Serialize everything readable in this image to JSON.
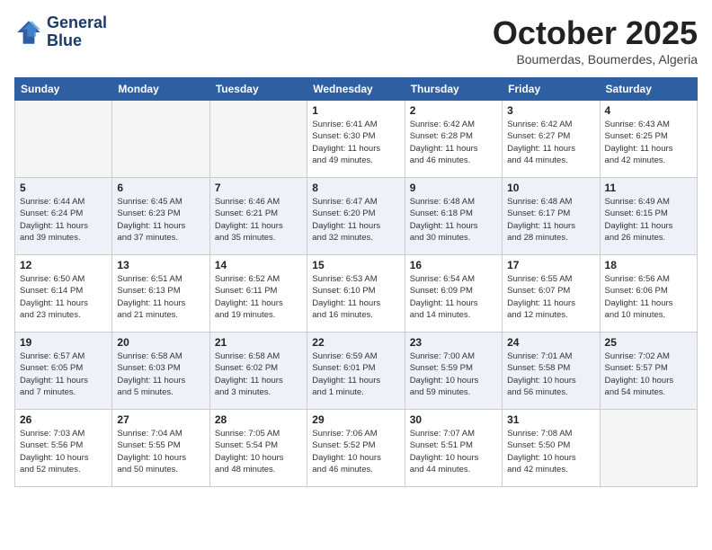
{
  "header": {
    "logo_line1": "General",
    "logo_line2": "Blue",
    "month": "October 2025",
    "location": "Boumerdas, Boumerdes, Algeria"
  },
  "weekdays": [
    "Sunday",
    "Monday",
    "Tuesday",
    "Wednesday",
    "Thursday",
    "Friday",
    "Saturday"
  ],
  "weeks": [
    [
      {
        "day": "",
        "info": ""
      },
      {
        "day": "",
        "info": ""
      },
      {
        "day": "",
        "info": ""
      },
      {
        "day": "1",
        "info": "Sunrise: 6:41 AM\nSunset: 6:30 PM\nDaylight: 11 hours\nand 49 minutes."
      },
      {
        "day": "2",
        "info": "Sunrise: 6:42 AM\nSunset: 6:28 PM\nDaylight: 11 hours\nand 46 minutes."
      },
      {
        "day": "3",
        "info": "Sunrise: 6:42 AM\nSunset: 6:27 PM\nDaylight: 11 hours\nand 44 minutes."
      },
      {
        "day": "4",
        "info": "Sunrise: 6:43 AM\nSunset: 6:25 PM\nDaylight: 11 hours\nand 42 minutes."
      }
    ],
    [
      {
        "day": "5",
        "info": "Sunrise: 6:44 AM\nSunset: 6:24 PM\nDaylight: 11 hours\nand 39 minutes."
      },
      {
        "day": "6",
        "info": "Sunrise: 6:45 AM\nSunset: 6:23 PM\nDaylight: 11 hours\nand 37 minutes."
      },
      {
        "day": "7",
        "info": "Sunrise: 6:46 AM\nSunset: 6:21 PM\nDaylight: 11 hours\nand 35 minutes."
      },
      {
        "day": "8",
        "info": "Sunrise: 6:47 AM\nSunset: 6:20 PM\nDaylight: 11 hours\nand 32 minutes."
      },
      {
        "day": "9",
        "info": "Sunrise: 6:48 AM\nSunset: 6:18 PM\nDaylight: 11 hours\nand 30 minutes."
      },
      {
        "day": "10",
        "info": "Sunrise: 6:48 AM\nSunset: 6:17 PM\nDaylight: 11 hours\nand 28 minutes."
      },
      {
        "day": "11",
        "info": "Sunrise: 6:49 AM\nSunset: 6:15 PM\nDaylight: 11 hours\nand 26 minutes."
      }
    ],
    [
      {
        "day": "12",
        "info": "Sunrise: 6:50 AM\nSunset: 6:14 PM\nDaylight: 11 hours\nand 23 minutes."
      },
      {
        "day": "13",
        "info": "Sunrise: 6:51 AM\nSunset: 6:13 PM\nDaylight: 11 hours\nand 21 minutes."
      },
      {
        "day": "14",
        "info": "Sunrise: 6:52 AM\nSunset: 6:11 PM\nDaylight: 11 hours\nand 19 minutes."
      },
      {
        "day": "15",
        "info": "Sunrise: 6:53 AM\nSunset: 6:10 PM\nDaylight: 11 hours\nand 16 minutes."
      },
      {
        "day": "16",
        "info": "Sunrise: 6:54 AM\nSunset: 6:09 PM\nDaylight: 11 hours\nand 14 minutes."
      },
      {
        "day": "17",
        "info": "Sunrise: 6:55 AM\nSunset: 6:07 PM\nDaylight: 11 hours\nand 12 minutes."
      },
      {
        "day": "18",
        "info": "Sunrise: 6:56 AM\nSunset: 6:06 PM\nDaylight: 11 hours\nand 10 minutes."
      }
    ],
    [
      {
        "day": "19",
        "info": "Sunrise: 6:57 AM\nSunset: 6:05 PM\nDaylight: 11 hours\nand 7 minutes."
      },
      {
        "day": "20",
        "info": "Sunrise: 6:58 AM\nSunset: 6:03 PM\nDaylight: 11 hours\nand 5 minutes."
      },
      {
        "day": "21",
        "info": "Sunrise: 6:58 AM\nSunset: 6:02 PM\nDaylight: 11 hours\nand 3 minutes."
      },
      {
        "day": "22",
        "info": "Sunrise: 6:59 AM\nSunset: 6:01 PM\nDaylight: 11 hours\nand 1 minute."
      },
      {
        "day": "23",
        "info": "Sunrise: 7:00 AM\nSunset: 5:59 PM\nDaylight: 10 hours\nand 59 minutes."
      },
      {
        "day": "24",
        "info": "Sunrise: 7:01 AM\nSunset: 5:58 PM\nDaylight: 10 hours\nand 56 minutes."
      },
      {
        "day": "25",
        "info": "Sunrise: 7:02 AM\nSunset: 5:57 PM\nDaylight: 10 hours\nand 54 minutes."
      }
    ],
    [
      {
        "day": "26",
        "info": "Sunrise: 7:03 AM\nSunset: 5:56 PM\nDaylight: 10 hours\nand 52 minutes."
      },
      {
        "day": "27",
        "info": "Sunrise: 7:04 AM\nSunset: 5:55 PM\nDaylight: 10 hours\nand 50 minutes."
      },
      {
        "day": "28",
        "info": "Sunrise: 7:05 AM\nSunset: 5:54 PM\nDaylight: 10 hours\nand 48 minutes."
      },
      {
        "day": "29",
        "info": "Sunrise: 7:06 AM\nSunset: 5:52 PM\nDaylight: 10 hours\nand 46 minutes."
      },
      {
        "day": "30",
        "info": "Sunrise: 7:07 AM\nSunset: 5:51 PM\nDaylight: 10 hours\nand 44 minutes."
      },
      {
        "day": "31",
        "info": "Sunrise: 7:08 AM\nSunset: 5:50 PM\nDaylight: 10 hours\nand 42 minutes."
      },
      {
        "day": "",
        "info": ""
      }
    ]
  ]
}
